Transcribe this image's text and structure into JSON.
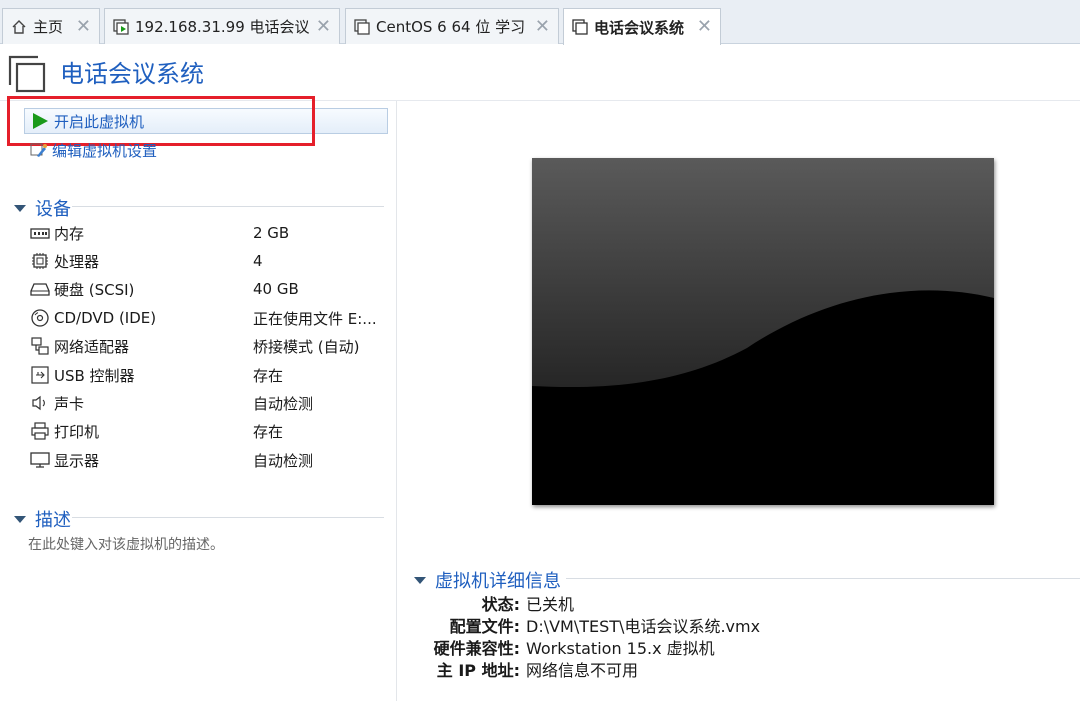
{
  "tabs": [
    {
      "label": "主页",
      "icon": "home-icon",
      "active": false
    },
    {
      "label": "192.168.31.99 电话会议",
      "icon": "vm-running-icon",
      "active": false
    },
    {
      "label": "CentOS 6 64 位 学习",
      "icon": "vm-icon",
      "active": false
    },
    {
      "label": "电话会议系统",
      "icon": "vm-icon",
      "active": true
    }
  ],
  "vm": {
    "title": "电话会议系统"
  },
  "actions": {
    "power_on": "开启此虚拟机",
    "edit_settings": "编辑虚拟机设置"
  },
  "devices": {
    "header": "设备",
    "items": [
      {
        "name": "内存",
        "value": "2 GB",
        "icon": "memory-icon"
      },
      {
        "name": "处理器",
        "value": "4",
        "icon": "cpu-icon"
      },
      {
        "name": "硬盘 (SCSI)",
        "value": "40 GB",
        "icon": "hard-disk-icon"
      },
      {
        "name": "CD/DVD (IDE)",
        "value": "正在使用文件 E:...",
        "icon": "cd-dvd-icon"
      },
      {
        "name": "网络适配器",
        "value": "桥接模式 (自动)",
        "icon": "network-adapter-icon"
      },
      {
        "name": "USB 控制器",
        "value": "存在",
        "icon": "usb-icon"
      },
      {
        "name": "声卡",
        "value": "自动检测",
        "icon": "sound-card-icon"
      },
      {
        "name": "打印机",
        "value": "存在",
        "icon": "printer-icon"
      },
      {
        "name": "显示器",
        "value": "自动检测",
        "icon": "display-icon"
      }
    ]
  },
  "description": {
    "header": "描述",
    "placeholder": "在此处键入对该虚拟机的描述。"
  },
  "details": {
    "header": "虚拟机详细信息",
    "rows": [
      {
        "key": "状态:",
        "value": "已关机"
      },
      {
        "key": "配置文件:",
        "value": "D:\\VM\\TEST\\电话会议系统.vmx"
      },
      {
        "key": "硬件兼容性:",
        "value": "Workstation 15.x 虚拟机"
      },
      {
        "key": "主 IP 地址:",
        "value": "网络信息不可用"
      }
    ]
  },
  "colors": {
    "accent": "#1f5fbf",
    "highlight_box": "#e51f2a",
    "play_green": "#1a9a1a"
  }
}
